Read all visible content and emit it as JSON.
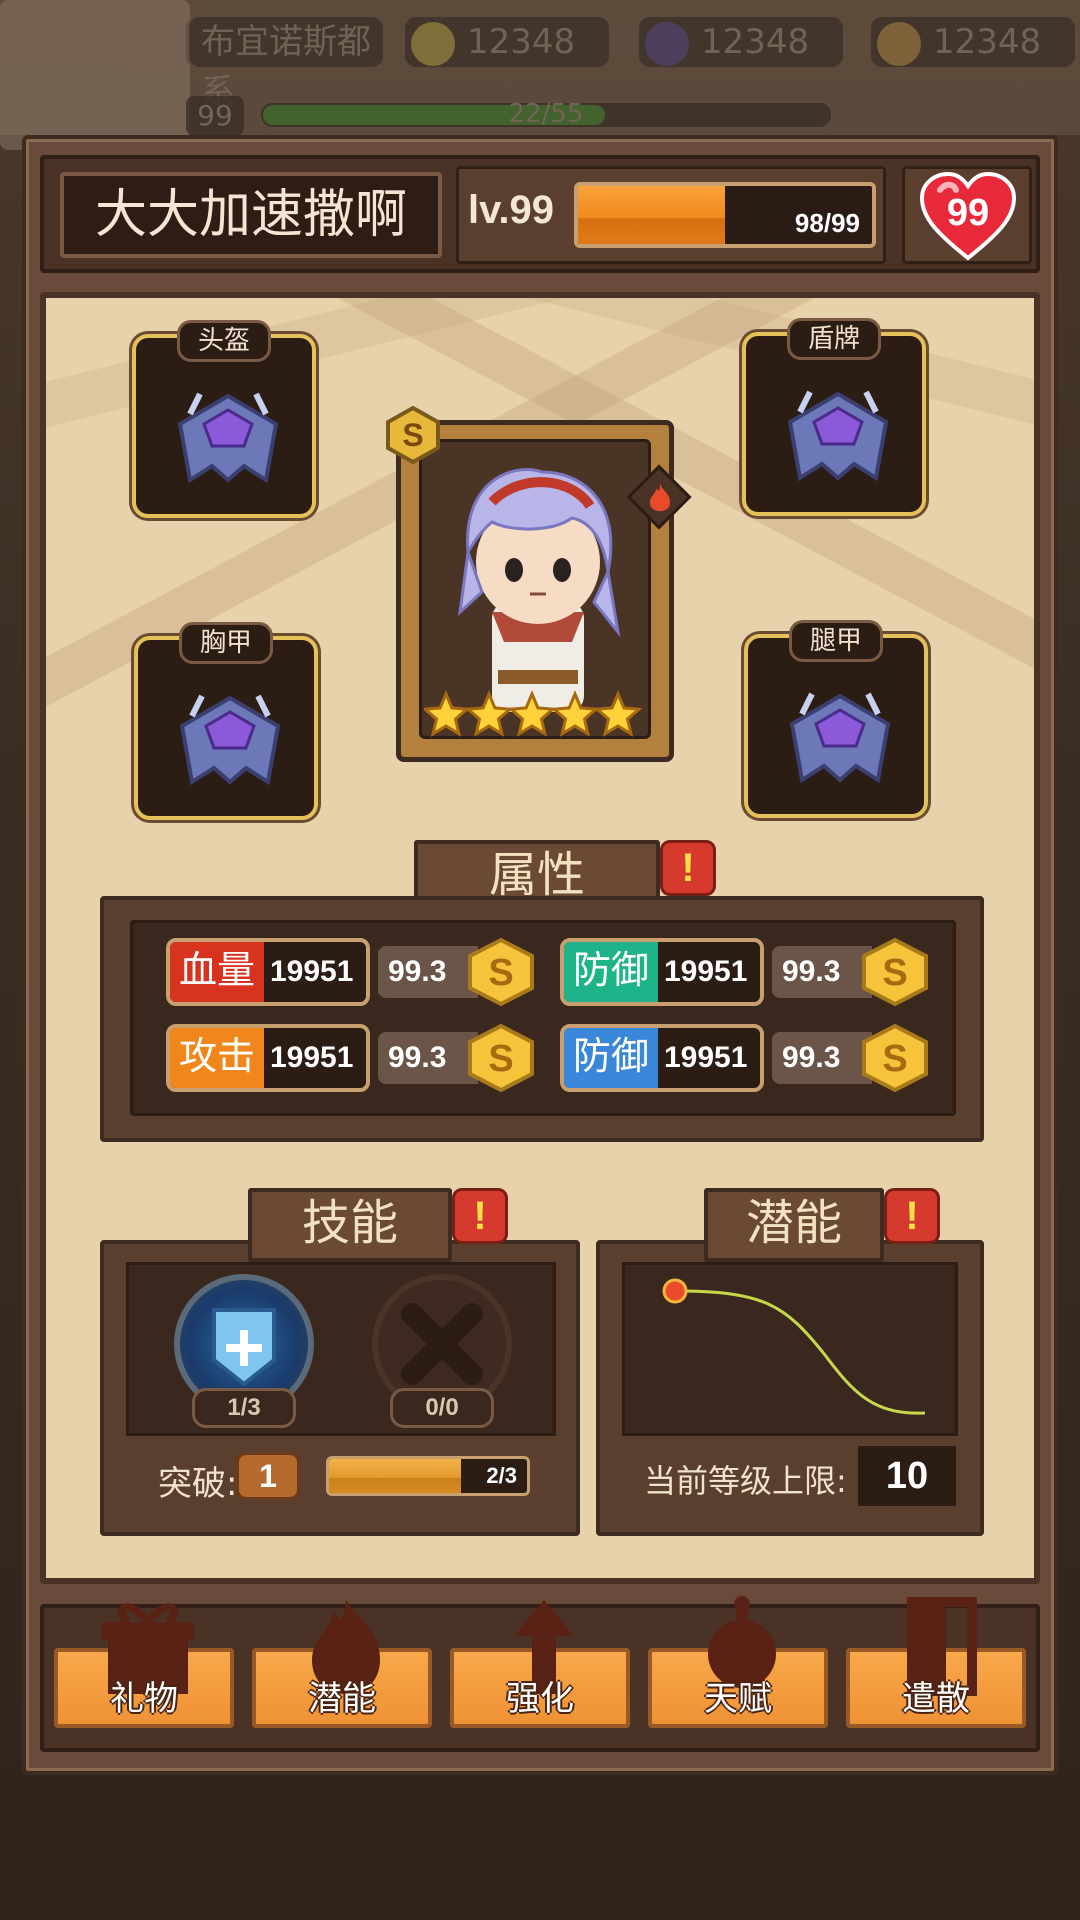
{
  "top_bar": {
    "faction_name": "布宜诺斯都系",
    "currencies": [
      {
        "name": "gold",
        "value": "12348"
      },
      {
        "name": "gem",
        "value": "12348"
      },
      {
        "name": "bread",
        "value": "12348"
      }
    ],
    "player_level": "99",
    "xp_text": "22/55"
  },
  "hero": {
    "name": "大大加速撒啊",
    "level_label": "lv.99",
    "exp_text": "98/99",
    "exp_progress": 0.5,
    "hearts": "99",
    "rank": "S",
    "stars": 5,
    "element_icon": "fire-icon"
  },
  "equipment": [
    {
      "slot": "头盔"
    },
    {
      "slot": "盾牌"
    },
    {
      "slot": "胸甲"
    },
    {
      "slot": "腿甲"
    }
  ],
  "attributes": {
    "title": "属性",
    "items": [
      {
        "name": "血量",
        "value": "19951",
        "pct": "99.3",
        "color": "#d8331f"
      },
      {
        "name": "防御",
        "value": "19951",
        "pct": "99.3",
        "color": "#1fb38a"
      },
      {
        "name": "攻击",
        "value": "19951",
        "pct": "99.3",
        "color": "#f0871c"
      },
      {
        "name": "防御",
        "value": "19951",
        "pct": "99.3",
        "color": "#3a86d8"
      }
    ],
    "coin_letter": "S"
  },
  "skills": {
    "title": "技能",
    "slots": [
      {
        "count": "1/3",
        "icon": "shield-skill-icon"
      },
      {
        "count": "0/0",
        "icon": "locked-x-icon"
      }
    ],
    "breakthrough_label": "突破:",
    "breakthrough_value": "1",
    "breakthrough_progress_text": "2/3",
    "breakthrough_progress": 0.6667
  },
  "potential": {
    "title": "潜能",
    "level_cap_label": "当前等级上限:",
    "level_cap_value": "10"
  },
  "toolbar": {
    "buttons": [
      {
        "label": "礼物",
        "icon": "gift-icon"
      },
      {
        "label": "潜能",
        "icon": "flame-icon"
      },
      {
        "label": "强化",
        "icon": "arrow-up-icon"
      },
      {
        "label": "天赋",
        "icon": "orb-icon"
      },
      {
        "label": "遣散",
        "icon": "door-icon"
      }
    ]
  },
  "alert_symbol": "!",
  "colors": {
    "accent_orange": "#f08a1e",
    "gold_border": "#e4c15a",
    "alert_red": "#d63a2e"
  }
}
